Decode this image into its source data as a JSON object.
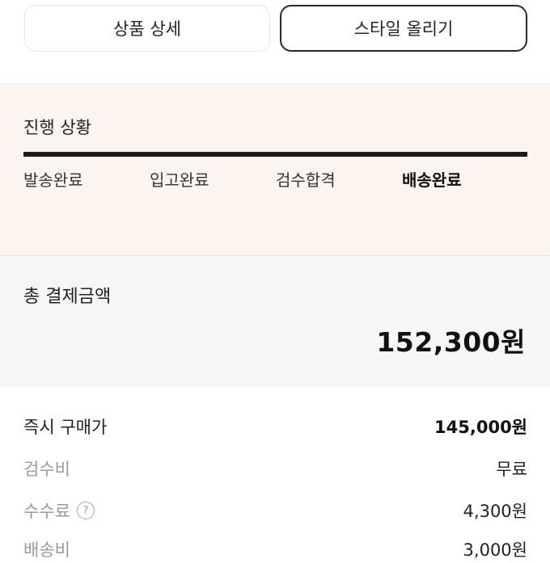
{
  "top_buttons": {
    "product_detail": "상품 상세",
    "upload_style": "스타일 올리기"
  },
  "progress": {
    "title": "진행 상황",
    "steps": [
      "발송완료",
      "입고완료",
      "검수합격",
      "배송완료"
    ],
    "active_step": "배송완료",
    "completion": 1.0
  },
  "total_payment": {
    "label": "총 결제금액",
    "value": "152,300원"
  },
  "breakdown": [
    {
      "label": "즉시 구매가",
      "value": "145,000원"
    },
    {
      "label": "검수비",
      "value": "무료"
    },
    {
      "label": "수수료",
      "value": "4,300원",
      "icon": "question-icon"
    },
    {
      "label": "배송비",
      "value": "3,000원"
    }
  ]
}
